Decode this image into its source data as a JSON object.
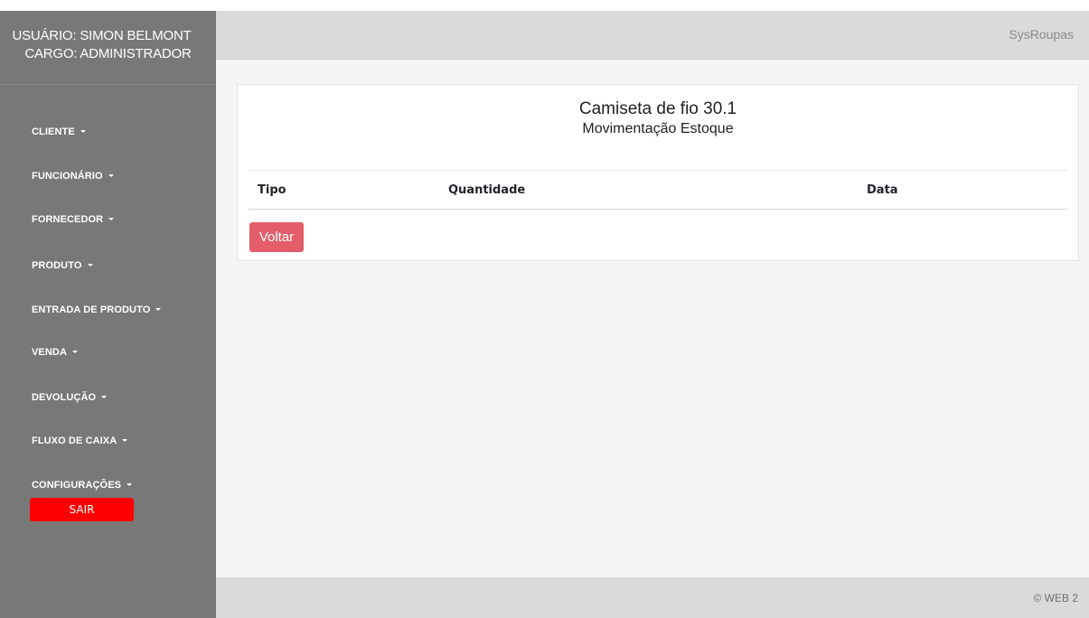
{
  "sidebar": {
    "user_line": "USUÁRIO: SIMON BELMONT",
    "role_line": "CARGO: ADMINISTRADOR",
    "menu": [
      {
        "label": "CLIENTE"
      },
      {
        "label": "FUNCIONÁRIO"
      },
      {
        "label": "FORNECEDOR"
      },
      {
        "label": "PRODUTO"
      },
      {
        "label": "ENTRADA DE PRODUTO"
      },
      {
        "label": "VENDA"
      },
      {
        "label": "DEVOLUÇÃO"
      },
      {
        "label": "FLUXO DE CAIXA"
      },
      {
        "label": "CONFIGURAÇÕES"
      }
    ],
    "logout_label": "SAIR"
  },
  "header": {
    "brand": "SysRoupas"
  },
  "card": {
    "title": "Camiseta de fio 30.1",
    "subtitle": "Movimentação Estoque",
    "columns": [
      "Tipo",
      "Quantidade",
      "Data"
    ],
    "rows": [],
    "back_label": "Voltar"
  },
  "footer": {
    "copyright": "© WEB 2"
  },
  "colors": {
    "sidebar_bg": "#787878",
    "header_bg": "#dadada",
    "logout_red": "#ff0000",
    "back_button": "#e35d6a"
  }
}
